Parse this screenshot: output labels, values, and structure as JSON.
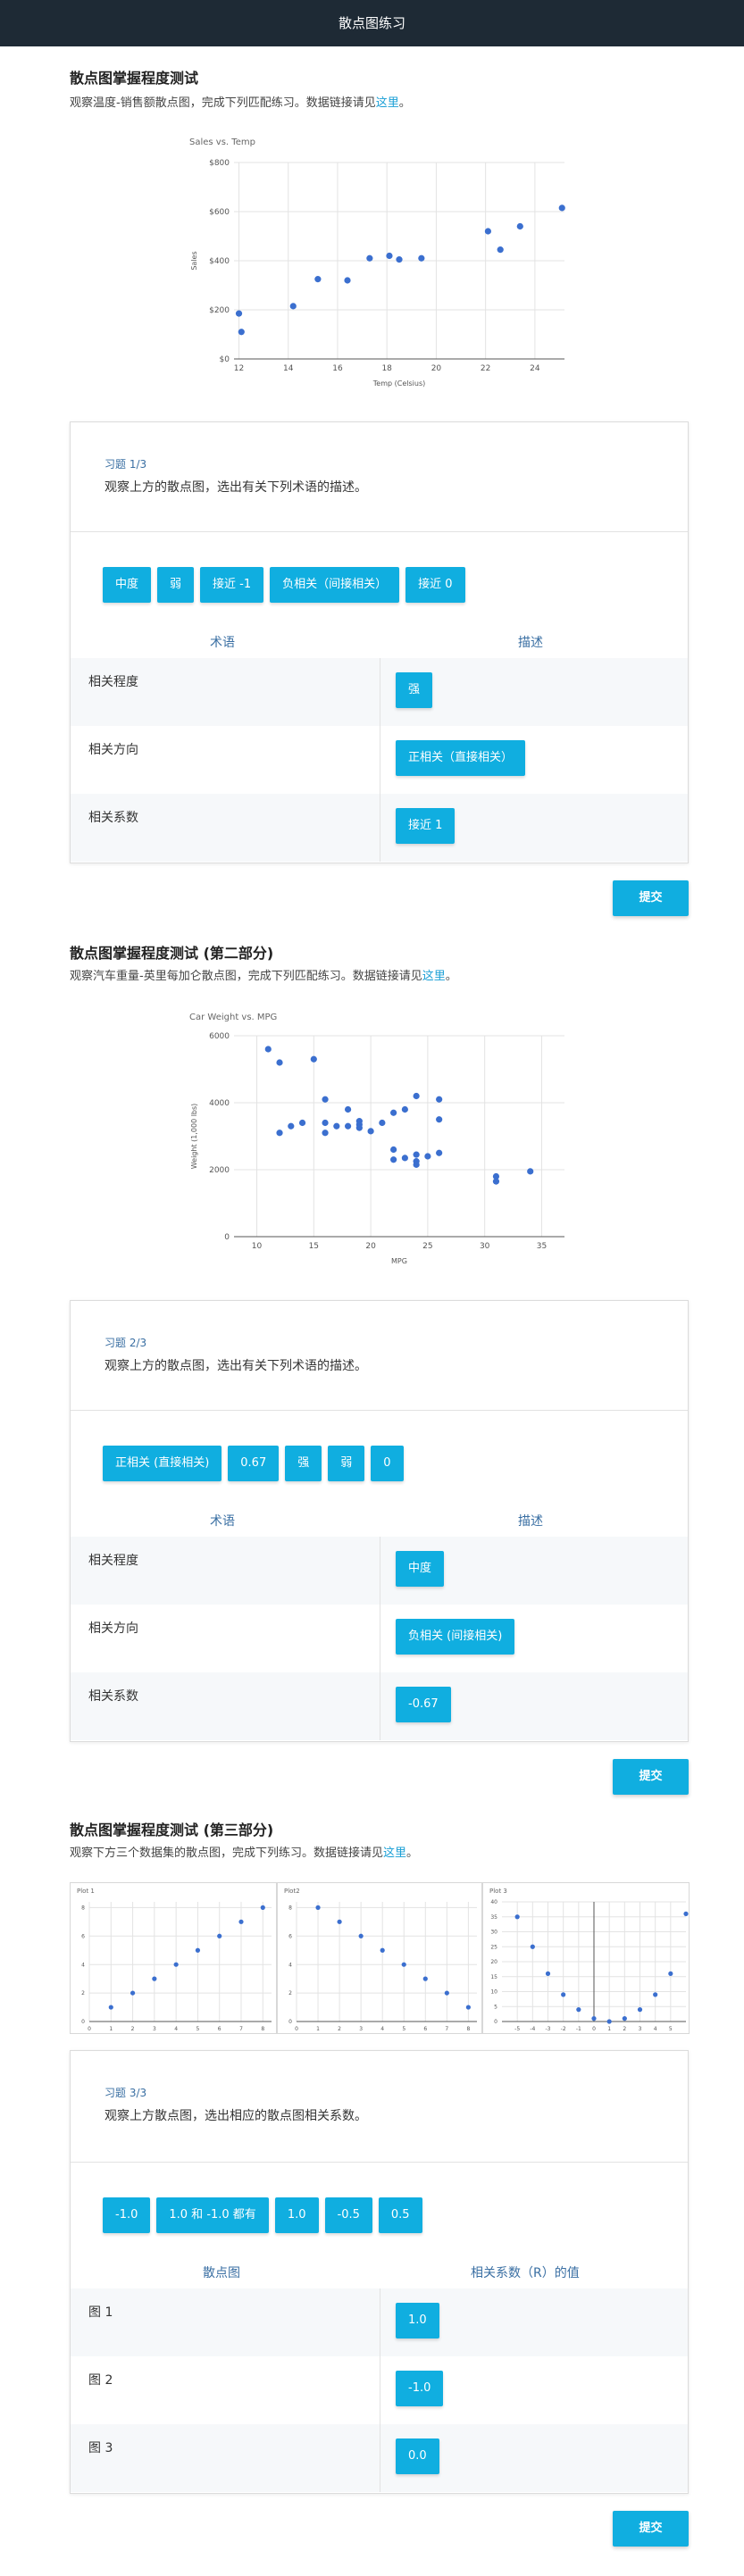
{
  "header": {
    "title": "散点图练习"
  },
  "sections": [
    {
      "title": "散点图掌握程度测试",
      "desc": "观察温度-销售额散点图，完成下列匹配练习。数据链接请见",
      "link": "这里",
      "desc_end": "。"
    },
    {
      "title": "散点图掌握程度测试 (第二部分)",
      "desc": "观察汽车重量-英里每加仑散点图，完成下列匹配练习。数据链接请见",
      "link": "这里",
      "desc_end": "。"
    },
    {
      "title": "散点图掌握程度测试 (第三部分)",
      "desc": "观察下方三个数据集的散点图，完成下列练习。数据链接请见",
      "link": "这里",
      "desc_end": "。"
    }
  ],
  "exercises": [
    {
      "label": "习题 1/3",
      "question": "观察上方的散点图，选出有关下列术语的描述。",
      "options": [
        "中度",
        "弱",
        "接近 -1",
        "负相关（间接相关）",
        "接近 0"
      ],
      "col_left": "术语",
      "col_right": "描述",
      "rows": [
        {
          "term": "相关程度",
          "answer": "强"
        },
        {
          "term": "相关方向",
          "answer": "正相关（直接相关）"
        },
        {
          "term": "相关系数",
          "answer": "接近 1"
        }
      ],
      "submit": "提交"
    },
    {
      "label": "习题 2/3",
      "question": "观察上方的散点图，选出有关下列术语的描述。",
      "options": [
        "正相关 (直接相关)",
        "0.67",
        "强",
        "弱",
        "0"
      ],
      "col_left": "术语",
      "col_right": "描述",
      "rows": [
        {
          "term": "相关程度",
          "answer": "中度"
        },
        {
          "term": "相关方向",
          "answer": "负相关 (间接相关)"
        },
        {
          "term": "相关系数",
          "answer": "-0.67"
        }
      ],
      "submit": "提交"
    },
    {
      "label": "习题 3/3",
      "question": "观察上方散点图，选出相应的散点图相关系数。",
      "options": [
        "-1.0",
        "1.0 和 -1.0 都有",
        "1.0",
        "-0.5",
        "0.5"
      ],
      "col_left": "散点图",
      "col_right": "相关系数（R）的值",
      "rows": [
        {
          "term": "图 1",
          "answer": "1.0"
        },
        {
          "term": "图 2",
          "answer": "-1.0"
        },
        {
          "term": "图 3",
          "answer": "0.0"
        }
      ],
      "submit": "提交"
    }
  ],
  "colors": {
    "accent": "#10aee0",
    "point": "#3b6fcf",
    "header_bg": "#1e2a35"
  },
  "chart_data": [
    {
      "type": "scatter",
      "title": "Sales vs. Temp",
      "xlabel": "Temp (Celsius)",
      "ylabel": "Sales",
      "xlim": [
        11.8,
        25.2
      ],
      "ylim": [
        0,
        800
      ],
      "xticks": [
        12,
        14,
        16,
        18,
        20,
        22,
        24
      ],
      "xtick_labels": [
        "12",
        "14",
        "16",
        "18",
        "20",
        "22",
        "24"
      ],
      "yticks": [
        0,
        200,
        400,
        600,
        800
      ],
      "ytick_labels": [
        "$0",
        "$200",
        "$400",
        "$600",
        "$800"
      ],
      "x": [
        12.0,
        12.1,
        14.2,
        15.2,
        16.4,
        17.3,
        18.1,
        18.5,
        19.4,
        22.1,
        22.6,
        23.4,
        25.1
      ],
      "y": [
        185,
        110,
        215,
        325,
        320,
        410,
        420,
        405,
        410,
        520,
        445,
        540,
        615
      ],
      "grid": true
    },
    {
      "type": "scatter",
      "title": "Car Weight vs. MPG",
      "xlabel": "MPG",
      "ylabel": "Weight (1,000 lbs)",
      "xlim": [
        8,
        37
      ],
      "ylim": [
        0,
        6000
      ],
      "xticks": [
        10,
        15,
        20,
        25,
        30,
        35
      ],
      "xtick_labels": [
        "10",
        "15",
        "20",
        "25",
        "30",
        "35"
      ],
      "yticks": [
        0,
        2000,
        4000,
        6000
      ],
      "ytick_labels": [
        "0",
        "2000",
        "4000",
        "6000"
      ],
      "x": [
        11,
        12,
        12,
        13,
        14,
        15,
        16,
        16,
        16,
        17,
        18,
        18,
        19,
        19,
        19,
        20,
        21,
        22,
        22,
        22,
        23,
        23,
        24,
        24,
        24,
        24,
        25,
        26,
        26,
        26,
        31,
        31,
        34
      ],
      "y": [
        5600,
        5200,
        3100,
        3300,
        3400,
        5300,
        4100,
        3400,
        3100,
        3300,
        3800,
        3300,
        3450,
        3350,
        3250,
        3150,
        3400,
        3700,
        2600,
        2300,
        3800,
        2350,
        4200,
        2450,
        2250,
        2150,
        2400,
        4100,
        3500,
        2500,
        1800,
        1650,
        1950
      ],
      "grid": true
    },
    {
      "type": "scatter",
      "title": "Plot 1",
      "xlim": [
        0,
        8.4
      ],
      "ylim": [
        0,
        8.4
      ],
      "xticks": [
        0,
        1,
        2,
        3,
        4,
        5,
        6,
        7,
        8
      ],
      "xtick_labels": [
        "0",
        "1",
        "2",
        "3",
        "4",
        "5",
        "6",
        "7",
        "8"
      ],
      "yticks": [
        0,
        2,
        4,
        6,
        8
      ],
      "ytick_labels": [
        "0",
        "2",
        "4",
        "6",
        "8"
      ],
      "x": [
        1,
        2,
        3,
        4,
        5,
        6,
        7,
        8
      ],
      "y": [
        1,
        2,
        3,
        4,
        5,
        6,
        7,
        8
      ],
      "grid": true
    },
    {
      "type": "scatter",
      "title": "Plot2",
      "xlim": [
        0,
        8.4
      ],
      "ylim": [
        0,
        8.4
      ],
      "xticks": [
        0,
        1,
        2,
        3,
        4,
        5,
        6,
        7,
        8
      ],
      "xtick_labels": [
        "0",
        "1",
        "2",
        "3",
        "4",
        "5",
        "6",
        "7",
        "8"
      ],
      "yticks": [
        0,
        2,
        4,
        6,
        8
      ],
      "ytick_labels": [
        "0",
        "2",
        "4",
        "6",
        "8"
      ],
      "x": [
        1,
        2,
        3,
        4,
        5,
        6,
        7,
        8
      ],
      "y": [
        8,
        7,
        6,
        5,
        4,
        3,
        2,
        1
      ],
      "grid": true
    },
    {
      "type": "scatter",
      "title": "Plot 3",
      "xlim": [
        -6,
        6
      ],
      "ylim": [
        0,
        40
      ],
      "xticks": [
        -5,
        -4,
        -3,
        -2,
        -1,
        0,
        1,
        2,
        3,
        4,
        5
      ],
      "xtick_labels": [
        "-5",
        "-4",
        "-3",
        "-2",
        "-1",
        "0",
        "1",
        "2",
        "3",
        "4",
        "5"
      ],
      "yticks": [
        0,
        5,
        10,
        15,
        20,
        25,
        30,
        35,
        40
      ],
      "ytick_labels": [
        "0",
        "5",
        "10",
        "15",
        "20",
        "25",
        "30",
        "35",
        "40"
      ],
      "x": [
        -5,
        -4,
        -3,
        -2,
        -1,
        0,
        1,
        2,
        3,
        4,
        5,
        6
      ],
      "y": [
        35,
        25,
        16,
        9,
        4,
        1,
        0,
        1,
        4,
        9,
        16,
        36
      ],
      "grid": true
    }
  ]
}
